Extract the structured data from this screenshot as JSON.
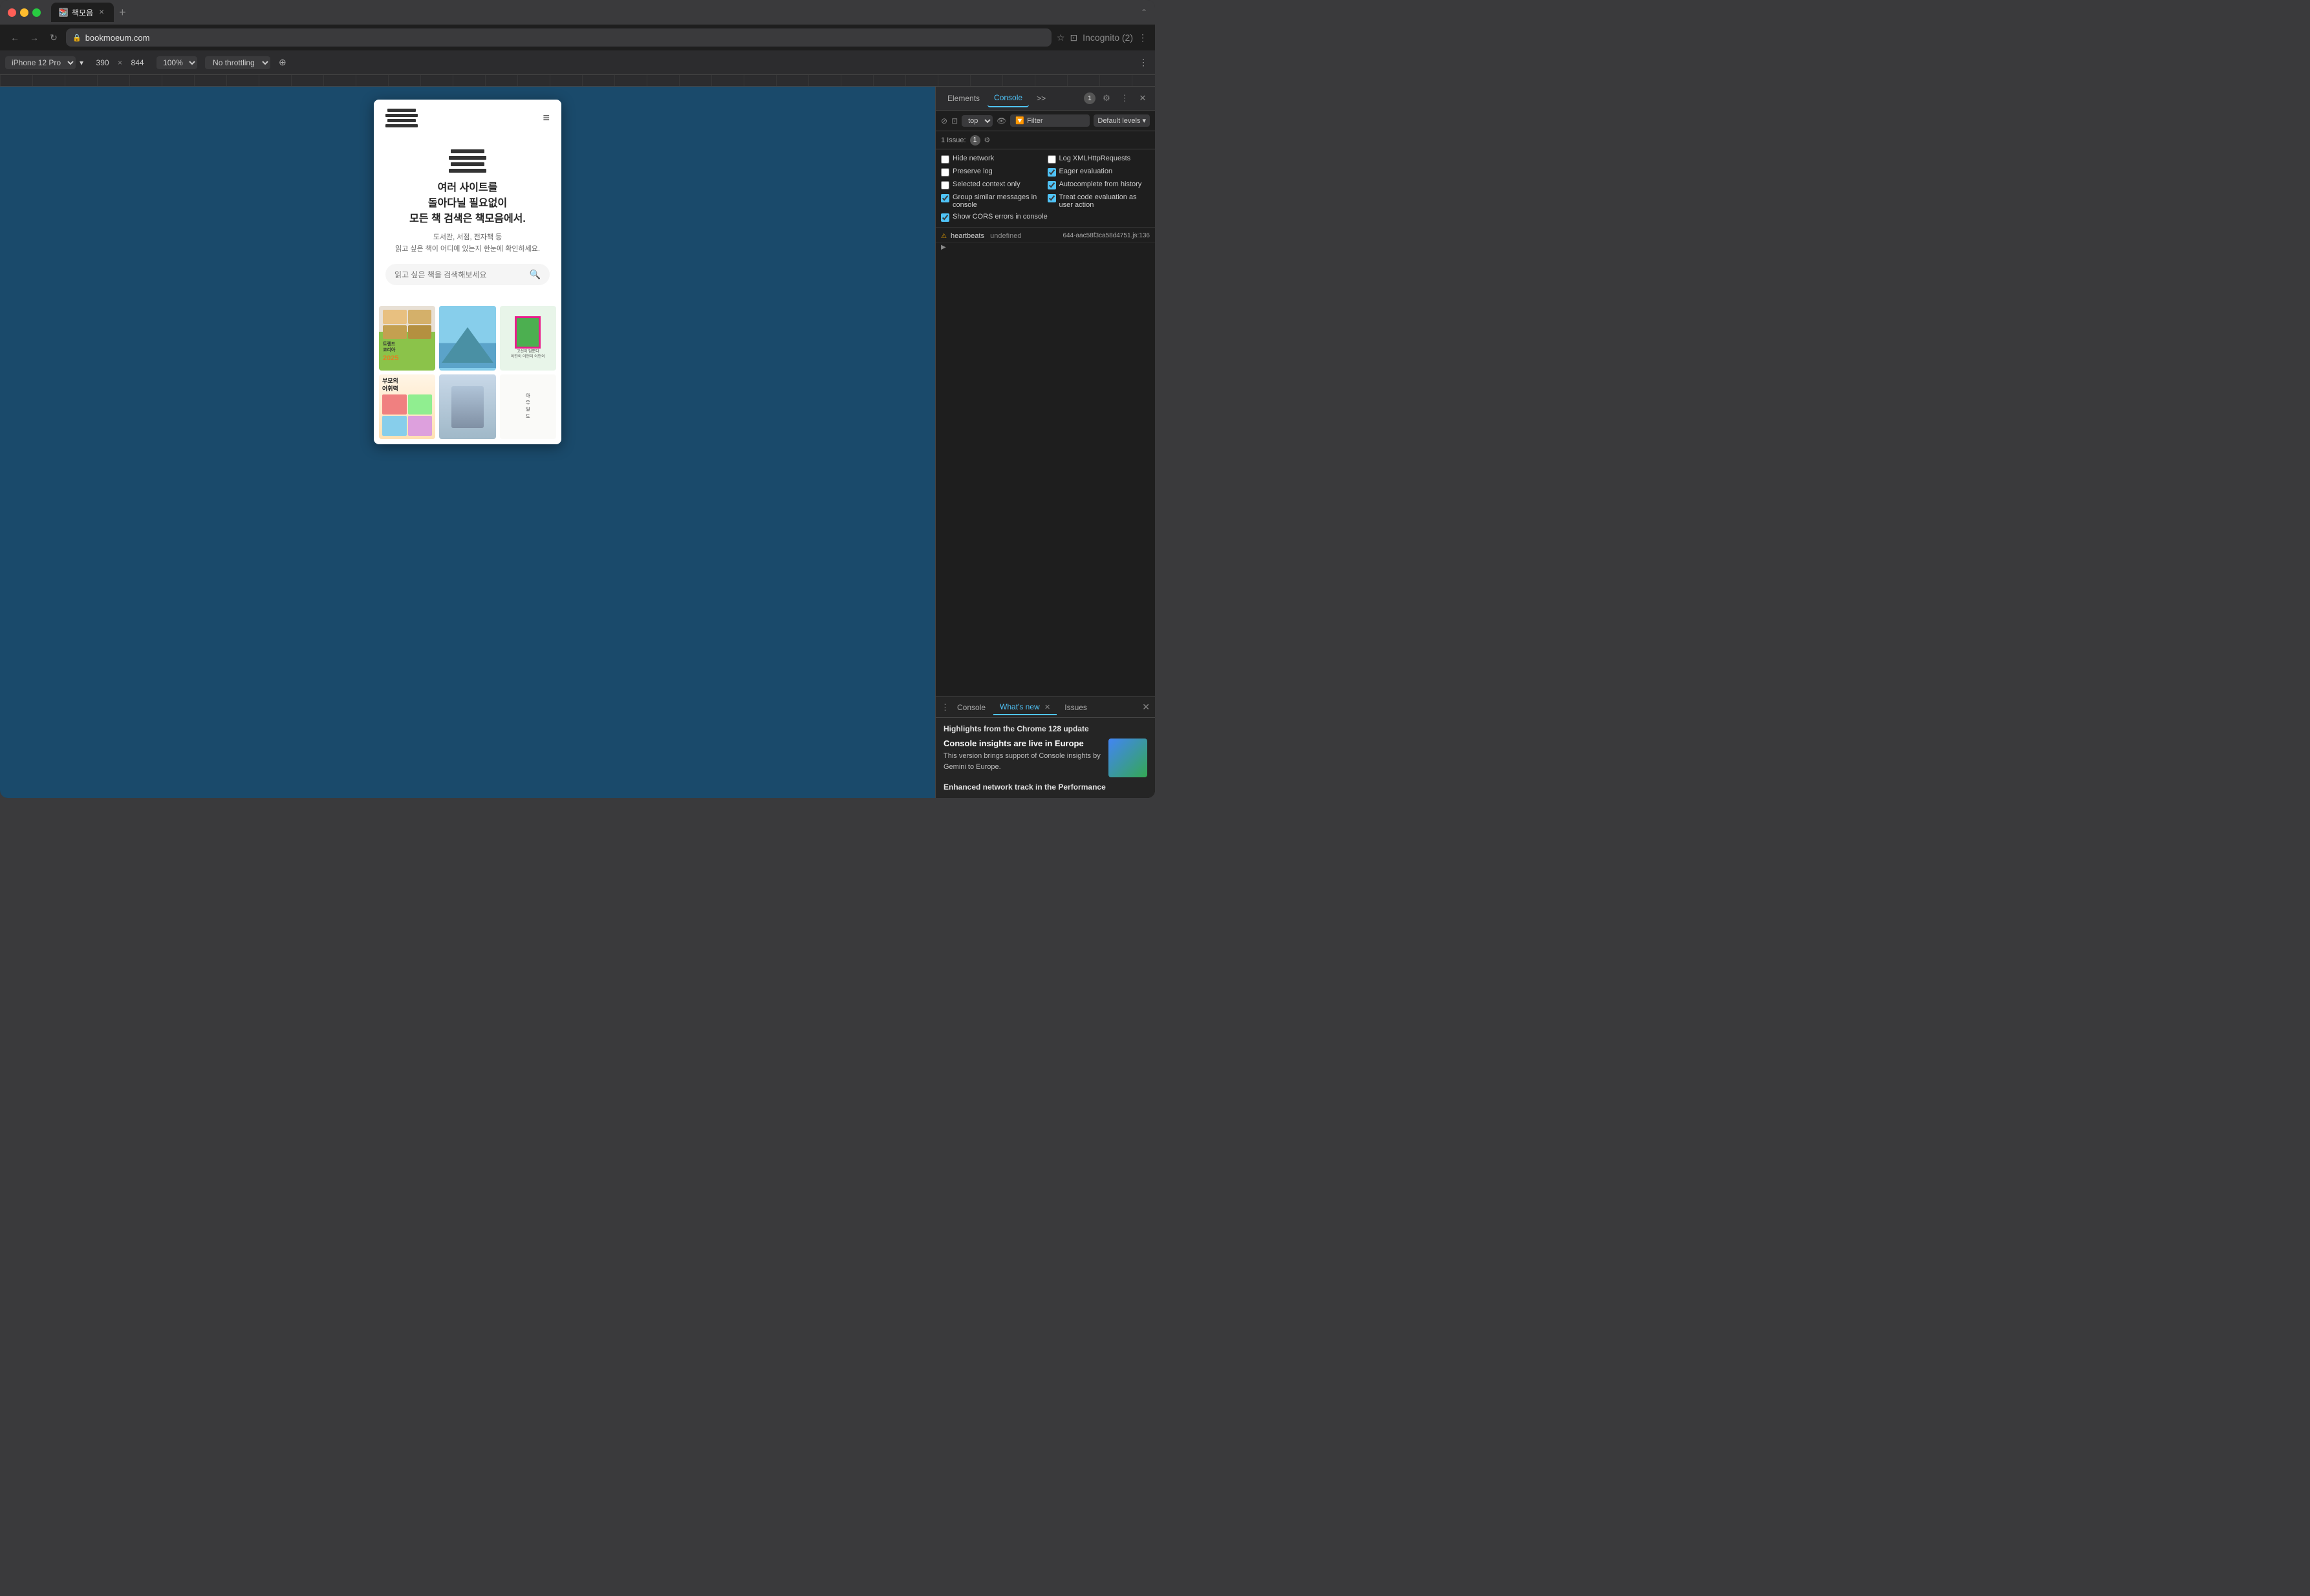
{
  "browser": {
    "title": "책모음",
    "url": "bookmoeum.com",
    "incognito_label": "Incognito (2)"
  },
  "devtools_bar": {
    "device": "iPhone 12 Pro",
    "width": "390",
    "height": "844",
    "zoom": "100%",
    "throttle": "No throttling"
  },
  "devtools": {
    "tabs": [
      "Elements",
      "Console",
      ">>"
    ],
    "active_tab": "Console",
    "context": "top",
    "filter_placeholder": "Filter",
    "default_levels": "Default levels",
    "issues_label": "1 Issue:",
    "issues_count": "1",
    "options": {
      "hide_network": "Hide network",
      "preserve_log": "Preserve log",
      "selected_context_only": "Selected context only",
      "group_similar": "Group similar messages in console",
      "show_cors": "Show CORS errors in console",
      "log_xml": "Log XMLHttpRequests",
      "eager_eval": "Eager evaluation",
      "autocomplete_history": "Autocomplete from history",
      "treat_code": "Treat code evaluation as user action"
    },
    "checked": {
      "group_similar": true,
      "show_cors": true,
      "eager_eval": true,
      "autocomplete_history": true,
      "treat_code": true
    },
    "console_entry": {
      "text": "heartbeats",
      "value": "undefined",
      "link": "644-aac58f3ca58d4751.js:136"
    }
  },
  "bottom_panel": {
    "tabs": [
      "Console",
      "What's new",
      "Issues"
    ],
    "active_tab": "What's new",
    "highlight_title": "Highlights from the Chrome 128 update",
    "section_title": "Console insights are live in Europe",
    "section_text": "This version brings support of Console insights by Gemini to Europe.",
    "section_link": "Enhanced network track in the Performance"
  },
  "mobile_site": {
    "title_line1": "여러 사이트를",
    "title_line2": "돌아다닐 필요없이",
    "title_line3": "모든 책 검색은 책모음에서.",
    "subtitle_line1": "도서관, 서점, 전자책 등",
    "subtitle_line2": "읽고 싶은 책이 어디에 있는지 한눈에 확인하세요.",
    "search_placeholder": "읽고 싶은 책을 검색해보세요"
  }
}
